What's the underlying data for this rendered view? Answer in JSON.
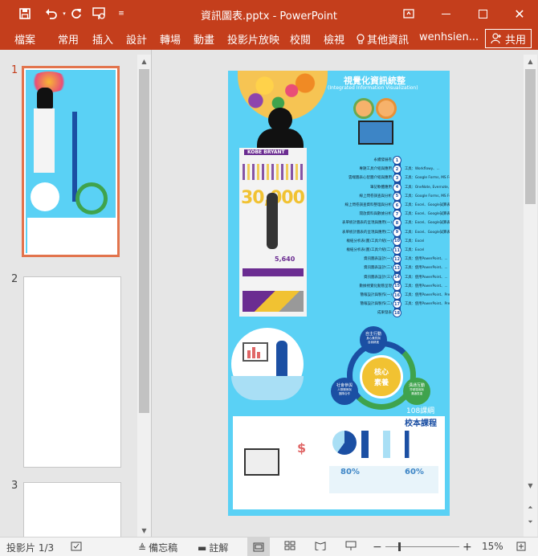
{
  "app": {
    "doc_title": "資訊圖表.pptx - PowerPoint",
    "qat": {
      "save_icon": "save-icon",
      "undo_icon": "undo-icon",
      "redo_icon": "redo-icon",
      "present_icon": "present-from-start-icon",
      "customize_icon": "customize-qat-icon"
    },
    "window": {
      "ribbon_display_icon": "ribbon-display-icon",
      "minimize_icon": "minimize-icon",
      "maximize_icon": "maximize-icon",
      "close_icon": "close-icon"
    }
  },
  "ribbon": {
    "tabs": [
      "檔案",
      "常用",
      "插入",
      "設計",
      "轉場",
      "動畫",
      "投影片放映",
      "校閱",
      "檢視"
    ],
    "tell_me": "其他資訊",
    "user": "wenhsien...",
    "share": "共用"
  },
  "thumbnails": [
    {
      "number": "1",
      "selected": true
    },
    {
      "number": "2",
      "selected": false
    },
    {
      "number": "3",
      "selected": false
    }
  ],
  "slide": {
    "title": "視覺化資訊統整",
    "subtitle": "(Integrated Information Visualization)",
    "kobe_label": "KOBE BRYANT",
    "big_number": "30,000",
    "stat_small": "5,640",
    "steps": [
      {
        "num": "1",
        "label": "永續發展卷",
        "tool": ""
      },
      {
        "num": "2",
        "label": "專題工具介紹與應用",
        "tool": "工具：Workflowy、..."
      },
      {
        "num": "3",
        "label": "雲端圖表心智圖介紹與應用",
        "tool": "工具：Google Forms, MS Forms、..."
      },
      {
        "num": "4",
        "label": "筆記軟體應用",
        "tool": "工具：OneNote, Evernote, Keep、..."
      },
      {
        "num": "5",
        "label": "線上問卷調查與分析",
        "tool": "工具：Google Forms, MS Forms、..."
      },
      {
        "num": "6",
        "label": "線上問卷調查資料整理與分析",
        "tool": "工具：Excel、Google試算表、..."
      },
      {
        "num": "7",
        "label": "開放資料與數據分析",
        "tool": "工具：Excel、Google試算表、..."
      },
      {
        "num": "8",
        "label": "表單統計圖表的呈現與應用(一)",
        "tool": "工具：Excel、Google試算表、..."
      },
      {
        "num": "9",
        "label": "表單統計圖表的呈現與應用(二)",
        "tool": "工具：Excel、Google試算表、..."
      },
      {
        "num": "10",
        "label": "樞紐分析表(圖)工具介紹(一)",
        "tool": "工具：Excel"
      },
      {
        "num": "11",
        "label": "樞紐分析表(圖)工具介紹(二)",
        "tool": "工具：Excel"
      },
      {
        "num": "12",
        "label": "資訊圖表設計(一)",
        "tool": "工具：使用PowerPoint、..."
      },
      {
        "num": "13",
        "label": "資訊圖表設計(二)",
        "tool": "工具：使用PowerPoint、..."
      },
      {
        "num": "14",
        "label": "資訊圖表設計(三)",
        "tool": "工具：使用PowerPoint、..."
      },
      {
        "num": "15",
        "label": "數據視覺化動態呈現",
        "tool": "工具：使用PowerPoint、..."
      },
      {
        "num": "16",
        "label": "簡報設計與製作(一)",
        "tool": "工具：使用PowerPoint、Prezi、..."
      },
      {
        "num": "17",
        "label": "簡報設計與製作(二)",
        "tool": "工具：使用PowerPoint、Prezi、..."
      },
      {
        "num": "18",
        "label": "成果發表",
        "tool": ""
      }
    ],
    "cycle": {
      "center": "核心\n素養",
      "top": "自主行動",
      "top_sub": "身心素質與\n自我精進",
      "left": "社會參與",
      "left_sub": "人際關係與\n團隊合作",
      "right": "溝通互動",
      "right_sub": "符號運用與\n溝通表達"
    },
    "course_tag": "108課綱",
    "course_name": "校本課程",
    "pct1": "80%",
    "pct2": "60%"
  },
  "status": {
    "slide_count": "投影片 1/3",
    "notes": "備忘稿",
    "comments": "註解",
    "zoom_out": "−",
    "zoom_in": "+",
    "zoom": "15%"
  }
}
